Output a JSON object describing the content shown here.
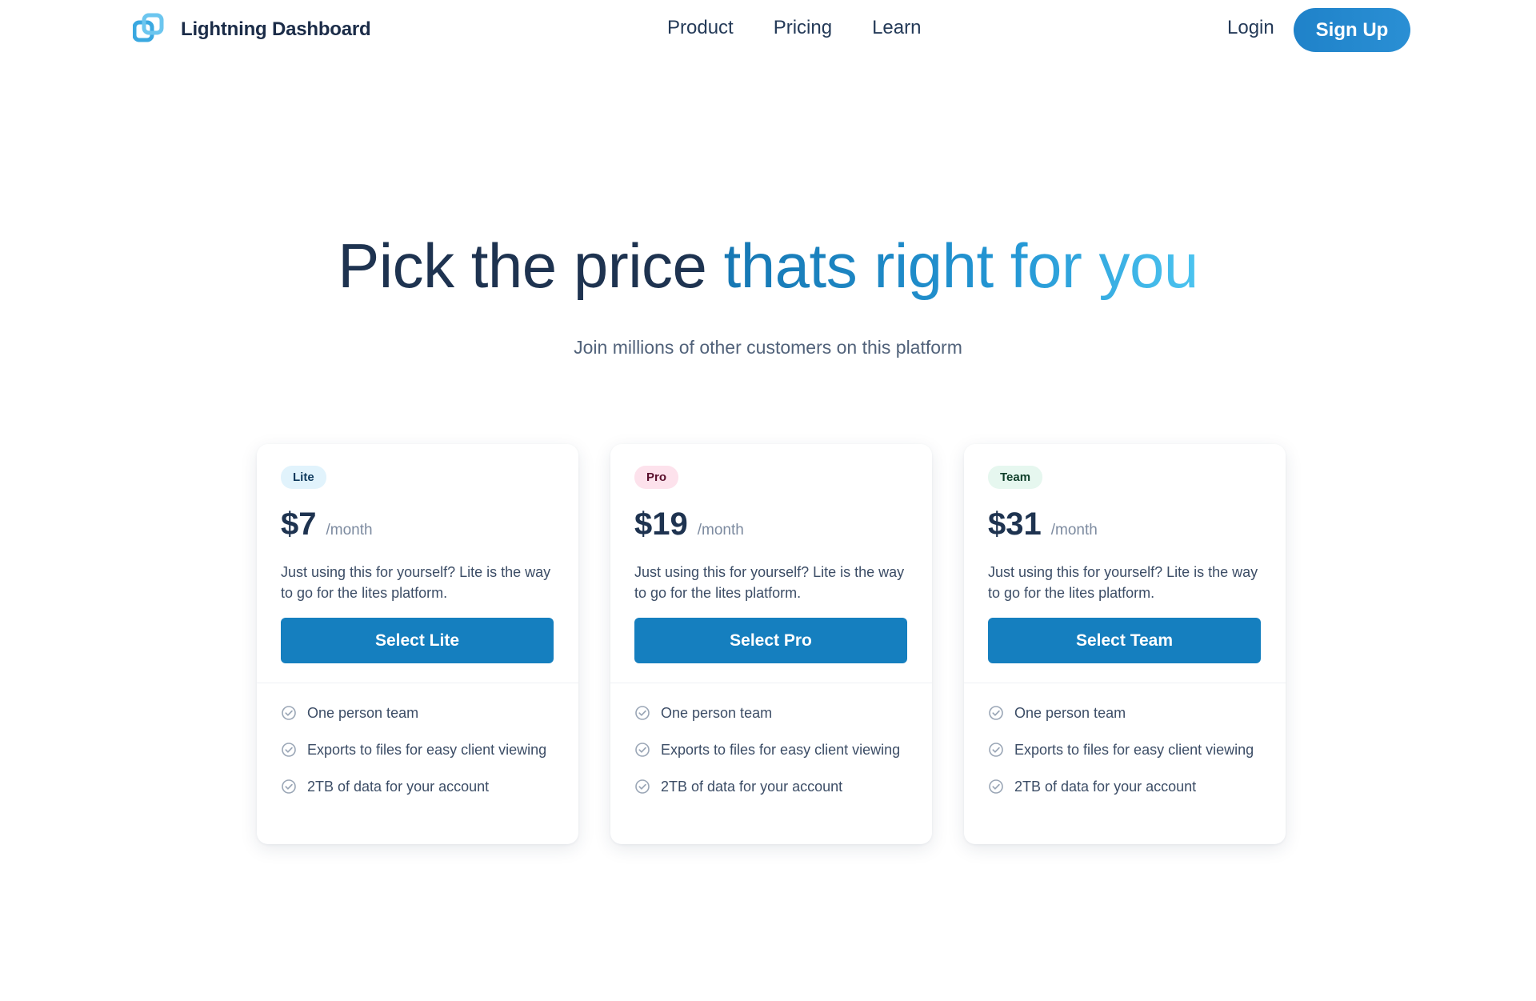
{
  "nav": {
    "brand": "Lightning Dashboard",
    "logo_icon": "overlapping-squares-logo-icon",
    "links": [
      "Product",
      "Pricing",
      "Learn"
    ],
    "login": "Login",
    "signup": "Sign Up"
  },
  "hero": {
    "title_plain": "Pick the price ",
    "title_accent": "thats right for you",
    "subtitle": "Join millions of other customers on this platform"
  },
  "plans": [
    {
      "badge": "Lite",
      "price": "$7",
      "period": "/month",
      "description": "Just using this for yourself? Lite is the way to go for the lites platform.",
      "button": "Select Lite",
      "features": [
        "One person team",
        "Exports to files for easy client viewing",
        "2TB of data for your account"
      ]
    },
    {
      "badge": "Pro",
      "price": "$19",
      "period": "/month",
      "description": "Just using this for yourself? Lite is the way to go for the lites platform.",
      "button": "Select Pro",
      "features": [
        "One person team",
        "Exports to files for easy client viewing",
        "2TB of data for your account"
      ]
    },
    {
      "badge": "Team",
      "price": "$31",
      "period": "/month",
      "description": "Just using this for yourself? Lite is the way to go for the lites platform.",
      "button": "Select Team",
      "features": [
        "One person team",
        "Exports to files for easy client viewing",
        "2TB of data for your account"
      ]
    }
  ],
  "colors": {
    "primary": "#157fbf",
    "text_dark": "#1e3350",
    "lite_badge_bg": "#e1f3fc",
    "pro_badge_bg": "#fde2ec",
    "team_badge_bg": "#e6f7ef"
  },
  "feature_icon": "check-circle-icon"
}
